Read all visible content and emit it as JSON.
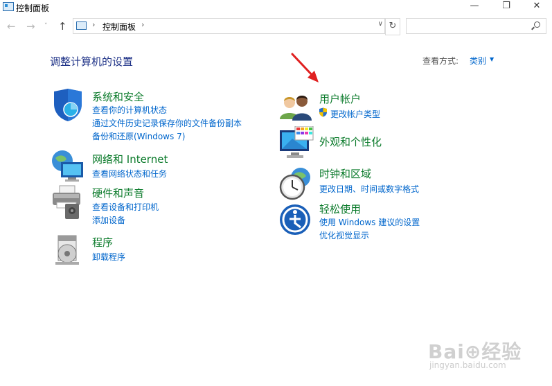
{
  "window": {
    "title": "控制面板",
    "minimize": "—",
    "maximize": "❐",
    "close": "✕"
  },
  "nav": {
    "back": "←",
    "forward": "→",
    "recent": "˅",
    "up": "↑",
    "address": "控制面板",
    "address_sep": "›",
    "address_dropdown": "∨",
    "refresh": "↻",
    "search_placeholder": ""
  },
  "main": {
    "heading": "调整计算机的设置",
    "view_label": "查看方式:",
    "view_value": "类别",
    "view_caret": "▼"
  },
  "categories": [
    {
      "title": "系统和安全",
      "links": [
        "查看你的计算机状态",
        "通过文件历史记录保存你的文件备份副本",
        "备份和还原(Windows 7)"
      ],
      "icon": "shield-icon"
    },
    {
      "title": "网络和 Internet",
      "links": [
        "查看网络状态和任务"
      ],
      "icon": "network-globe-icon"
    },
    {
      "title": "硬件和声音",
      "links": [
        "查看设备和打印机",
        "添加设备"
      ],
      "icon": "printer-icon"
    },
    {
      "title": "程序",
      "links": [
        "卸载程序"
      ],
      "icon": "program-disc-icon"
    },
    {
      "title": "用户帐户",
      "links": [
        "更改帐户类型"
      ],
      "icon": "users-icon"
    },
    {
      "title": "外观和个性化",
      "links": [],
      "icon": "monitor-palette-icon"
    },
    {
      "title": "时钟和区域",
      "links": [
        "更改日期、时间或数字格式"
      ],
      "icon": "clock-globe-icon"
    },
    {
      "title": "轻松使用",
      "links": [
        "使用 Windows 建议的设置",
        "优化视觉显示"
      ],
      "icon": "ease-of-access-icon"
    }
  ],
  "watermark": {
    "brand": "Bai⊕经验",
    "url": "jingyan.baidu.com"
  }
}
